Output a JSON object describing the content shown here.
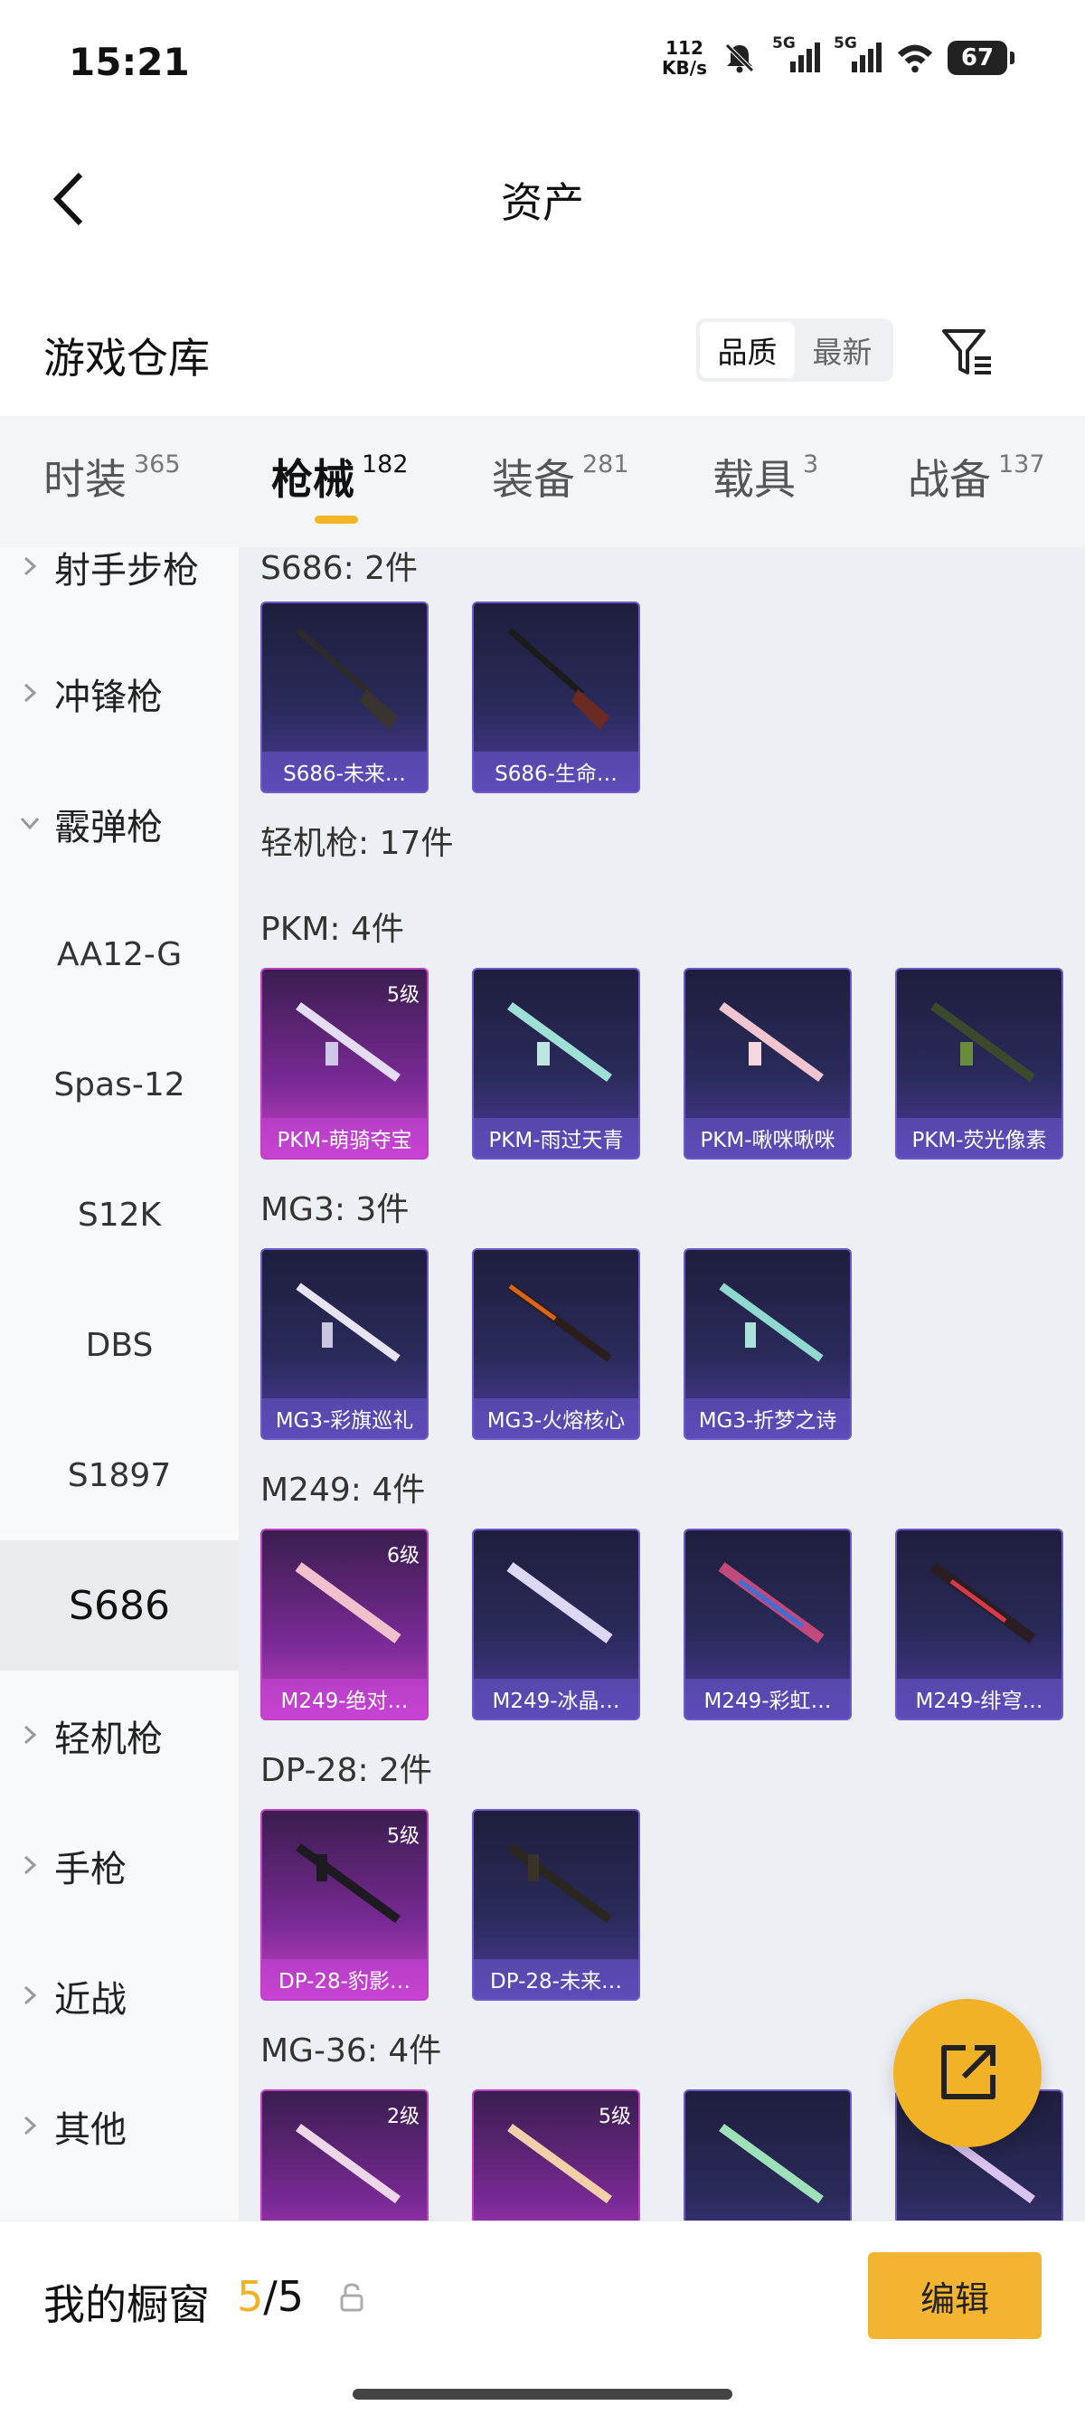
{
  "status": {
    "time": "15:21",
    "net_speed": "112",
    "net_unit": "KB/s",
    "sim1": "5G",
    "sim2": "5G",
    "battery": "67"
  },
  "header": {
    "title": "资产"
  },
  "warehouse": {
    "title": "游戏仓库",
    "sort_options": [
      "品质",
      "最新"
    ]
  },
  "tabs": [
    {
      "label": "时装",
      "count": "365"
    },
    {
      "label": "枪械",
      "count": "182"
    },
    {
      "label": "装备",
      "count": "281"
    },
    {
      "label": "载具",
      "count": "3"
    },
    {
      "label": "战备",
      "count": "137"
    }
  ],
  "sidebar": {
    "items": [
      {
        "label": "射手步枪"
      },
      {
        "label": "冲锋枪"
      },
      {
        "label": "霰弹枪"
      },
      {
        "label": "AA12-G"
      },
      {
        "label": "Spas-12"
      },
      {
        "label": "S12K"
      },
      {
        "label": "DBS"
      },
      {
        "label": "S1897"
      },
      {
        "label": "S686"
      },
      {
        "label": "轻机枪"
      },
      {
        "label": "手枪"
      },
      {
        "label": "近战"
      },
      {
        "label": "其他"
      }
    ]
  },
  "content": {
    "sections": [
      {
        "title": "S686: 2件"
      },
      {
        "title": "轻机枪: 17件"
      },
      {
        "title": "PKM: 4件"
      },
      {
        "title": "MG3: 3件"
      },
      {
        "title": "M249: 4件"
      },
      {
        "title": "DP-28: 2件"
      },
      {
        "title": "MG-36: 4件"
      }
    ],
    "cards": [
      {
        "name": "S686-未来…",
        "level": ""
      },
      {
        "name": "S686-生命…",
        "level": ""
      },
      {
        "name": "PKM-萌骑夺宝",
        "level": "5级"
      },
      {
        "name": "PKM-雨过天青",
        "level": ""
      },
      {
        "name": "PKM-啾咪啾咪",
        "level": ""
      },
      {
        "name": "PKM-荧光像素",
        "level": ""
      },
      {
        "name": "MG3-彩旗巡礼",
        "level": ""
      },
      {
        "name": "MG3-火熔核心",
        "level": ""
      },
      {
        "name": "MG3-折梦之诗",
        "level": ""
      },
      {
        "name": "M249-绝对…",
        "level": "6级"
      },
      {
        "name": "M249-冰晶…",
        "level": ""
      },
      {
        "name": "M249-彩虹…",
        "level": ""
      },
      {
        "name": "M249-绯穹…",
        "level": ""
      },
      {
        "name": "DP-28-豹影…",
        "level": "5级"
      },
      {
        "name": "DP-28-未来…",
        "level": ""
      },
      {
        "name": "",
        "level": "2级"
      },
      {
        "name": "",
        "level": "5级"
      },
      {
        "name": "",
        "level": ""
      },
      {
        "name": "",
        "level": ""
      }
    ]
  },
  "bottom": {
    "label": "我的橱窗",
    "current": "5",
    "total": "/5",
    "edit_label": "编辑"
  },
  "colors": {
    "accent": "#f3b531",
    "card_blue": "#2a2a5a",
    "card_purple": "#7a2a96"
  }
}
